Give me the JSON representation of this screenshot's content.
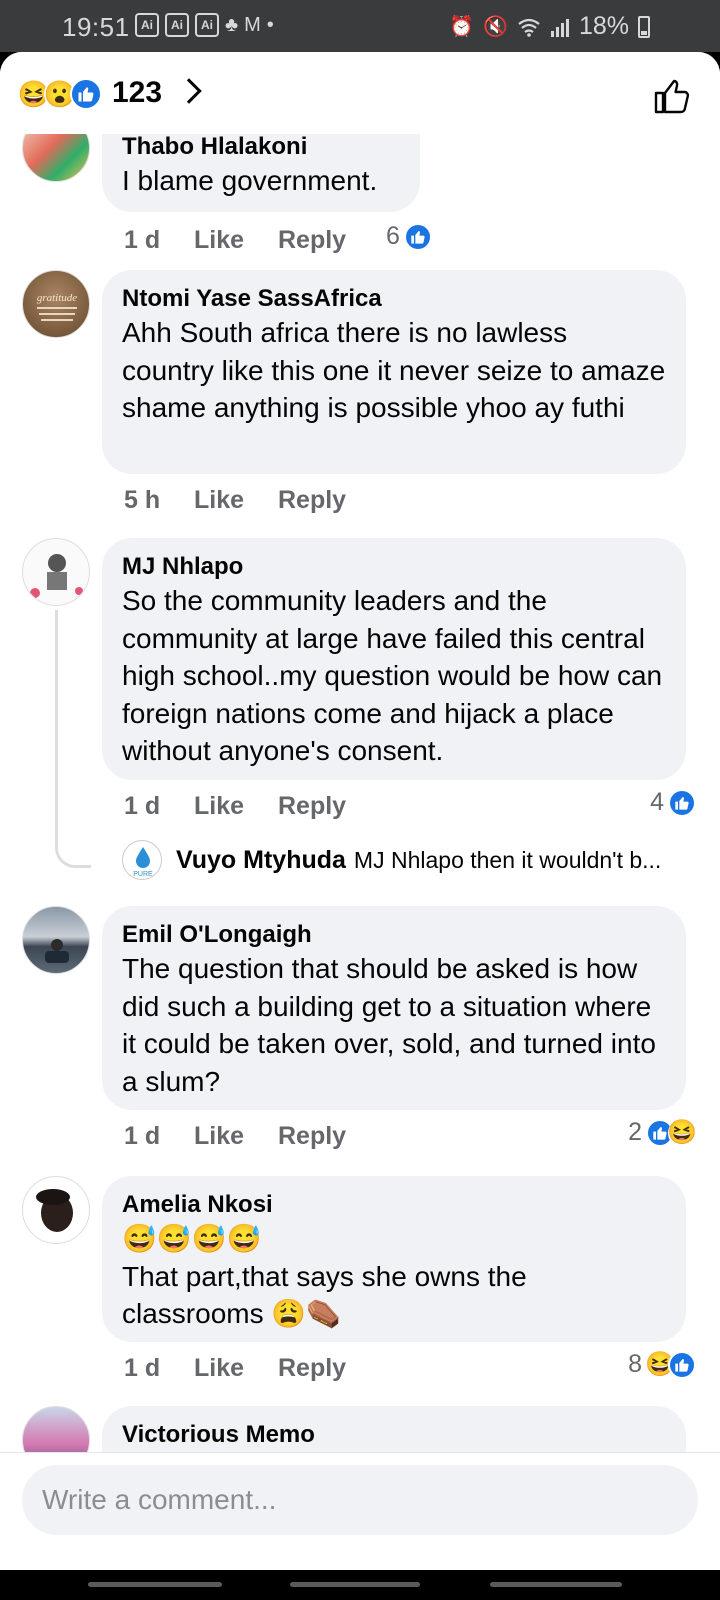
{
  "status_bar": {
    "time": "19:51",
    "app_icons": [
      "Ai",
      "Ai",
      "Ai"
    ],
    "battery": "18%"
  },
  "header": {
    "reaction_count": "123",
    "reactions": [
      "haha",
      "wow",
      "like"
    ]
  },
  "comments": [
    {
      "name": "Thabo Hlalakoni",
      "text": "I blame government.",
      "time": "1 d",
      "like_label": "Like",
      "reply_label": "Reply",
      "reaction_count": "6",
      "reactions": [
        "like"
      ]
    },
    {
      "name": "Ntomi Yase SassAfrica",
      "text": "Ahh South africa there is no lawless country like this one it never seize to amaze shame anything is possible yhoo ay futhi",
      "time": "5 h",
      "like_label": "Like",
      "reply_label": "Reply",
      "reaction_count": "",
      "reactions": []
    },
    {
      "name": "MJ Nhlapo",
      "text": "So the community leaders and the community at large have failed this central high school..my question would be how can foreign nations come and hijack a place without anyone's consent.",
      "time": "1 d",
      "like_label": "Like",
      "reply_label": "Reply",
      "reaction_count": "4",
      "reactions": [
        "like"
      ],
      "reply_preview": {
        "name": "Vuyo Mtyhuda",
        "text": "MJ Nhlapo then it wouldn't b...",
        "avatar_text": "PURE"
      }
    },
    {
      "name": "Emil O'Longaigh",
      "text": "The question that should be asked is how did such a building get to a situation where it could be taken over, sold, and turned into a slum?",
      "time": "1 d",
      "like_label": "Like",
      "reply_label": "Reply",
      "reaction_count": "2",
      "reactions": [
        "like",
        "haha"
      ]
    },
    {
      "name": "Amelia Nkosi",
      "emoji_line": "😅😅😅😅",
      "text": "That part,that says she owns the classrooms 😩⚰️",
      "time": "1 d",
      "like_label": "Like",
      "reply_label": "Reply",
      "reaction_count": "8",
      "reactions": [
        "haha",
        "like"
      ]
    },
    {
      "name": "Victorious Memo"
    }
  ],
  "composer": {
    "placeholder": "Write a comment..."
  },
  "colors": {
    "accent": "#1b74e4",
    "bubble": "#f0f2f5",
    "secondary_text": "#65676b"
  }
}
